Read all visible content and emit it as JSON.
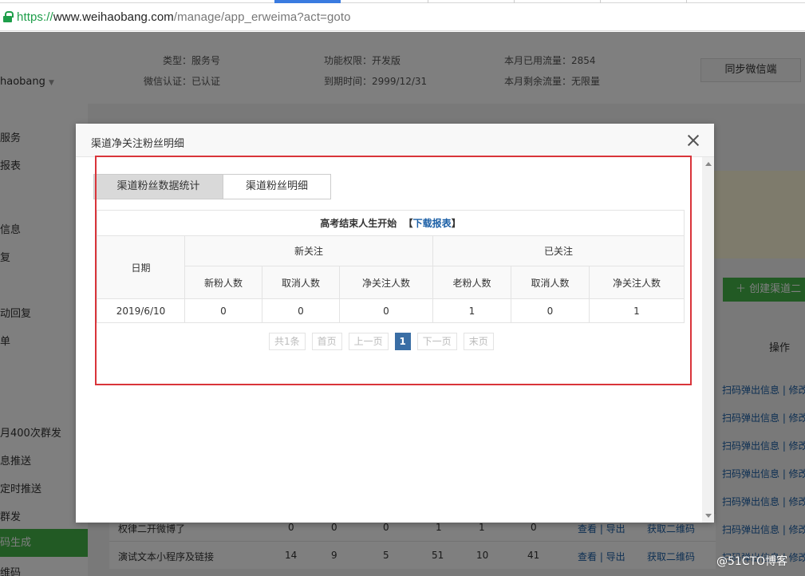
{
  "browser": {
    "url_scheme": "https://",
    "url_host": "www.weihaobang.com",
    "url_path": "/manage/app_erweima?act=goto"
  },
  "account": {
    "brand": "haobang",
    "type": "类型：服务号",
    "verify": "微信认证：已认证",
    "permission": "功能权限：开发版",
    "expire": "到期时间：2999/12/31",
    "used": "本月已用流量：2854",
    "remain": "本月剩余流量：无限量",
    "sync_button": "同步微信端"
  },
  "sidebar": {
    "items": [
      "服务",
      "报表",
      "信息",
      "复",
      "动回复",
      "单",
      "月400次群发",
      "息推送",
      "定时推送",
      "群发",
      "码生成",
      "维码"
    ]
  },
  "background": {
    "create_button": "创建渠道二",
    "op_header": "操作",
    "op_link": "扫码弹出信息 | 修改",
    "rows": [
      {
        "name": "权律二开微博了",
        "c1": "0",
        "c2": "0",
        "c3": "0",
        "c4": "1",
        "c5": "1",
        "c6": "0",
        "links": "查看 | 导出",
        "qr": "获取二维码"
      },
      {
        "name": "演试文本小程序及链接",
        "c1": "14",
        "c2": "9",
        "c3": "5",
        "c4": "51",
        "c5": "10",
        "c6": "41",
        "links": "查看 | 导出",
        "qr": "获取二维码"
      }
    ]
  },
  "modal": {
    "title": "渠道净关注粉丝明细",
    "tabs": [
      "渠道粉丝数据统计",
      "渠道粉丝明细"
    ],
    "table_caption": "高考结束人生开始",
    "download_open": "【",
    "download_label": "下载报表",
    "download_close": "】",
    "headers": {
      "date": "日期",
      "group_new": "新关注",
      "group_followed": "已关注",
      "new_fans": "新粉人数",
      "cancel_1": "取消人数",
      "net_1": "净关注人数",
      "old_fans": "老粉人数",
      "cancel_2": "取消人数",
      "net_2": "净关注人数"
    },
    "rows": [
      {
        "date": "2019/6/10",
        "new_fans": "0",
        "cancel_1": "0",
        "net_1": "0",
        "old_fans": "1",
        "cancel_2": "0",
        "net_2": "1"
      }
    ],
    "pager": {
      "total": "共1条",
      "first": "首页",
      "prev": "上一页",
      "current": "1",
      "next": "下一页",
      "last": "末页"
    }
  },
  "watermark": "@51CTO博客",
  "colors": {
    "accent_green": "#44b549",
    "link_blue": "#1b5fa6",
    "highlight_red": "#d9343a",
    "pager_active": "#3a6ea5"
  }
}
